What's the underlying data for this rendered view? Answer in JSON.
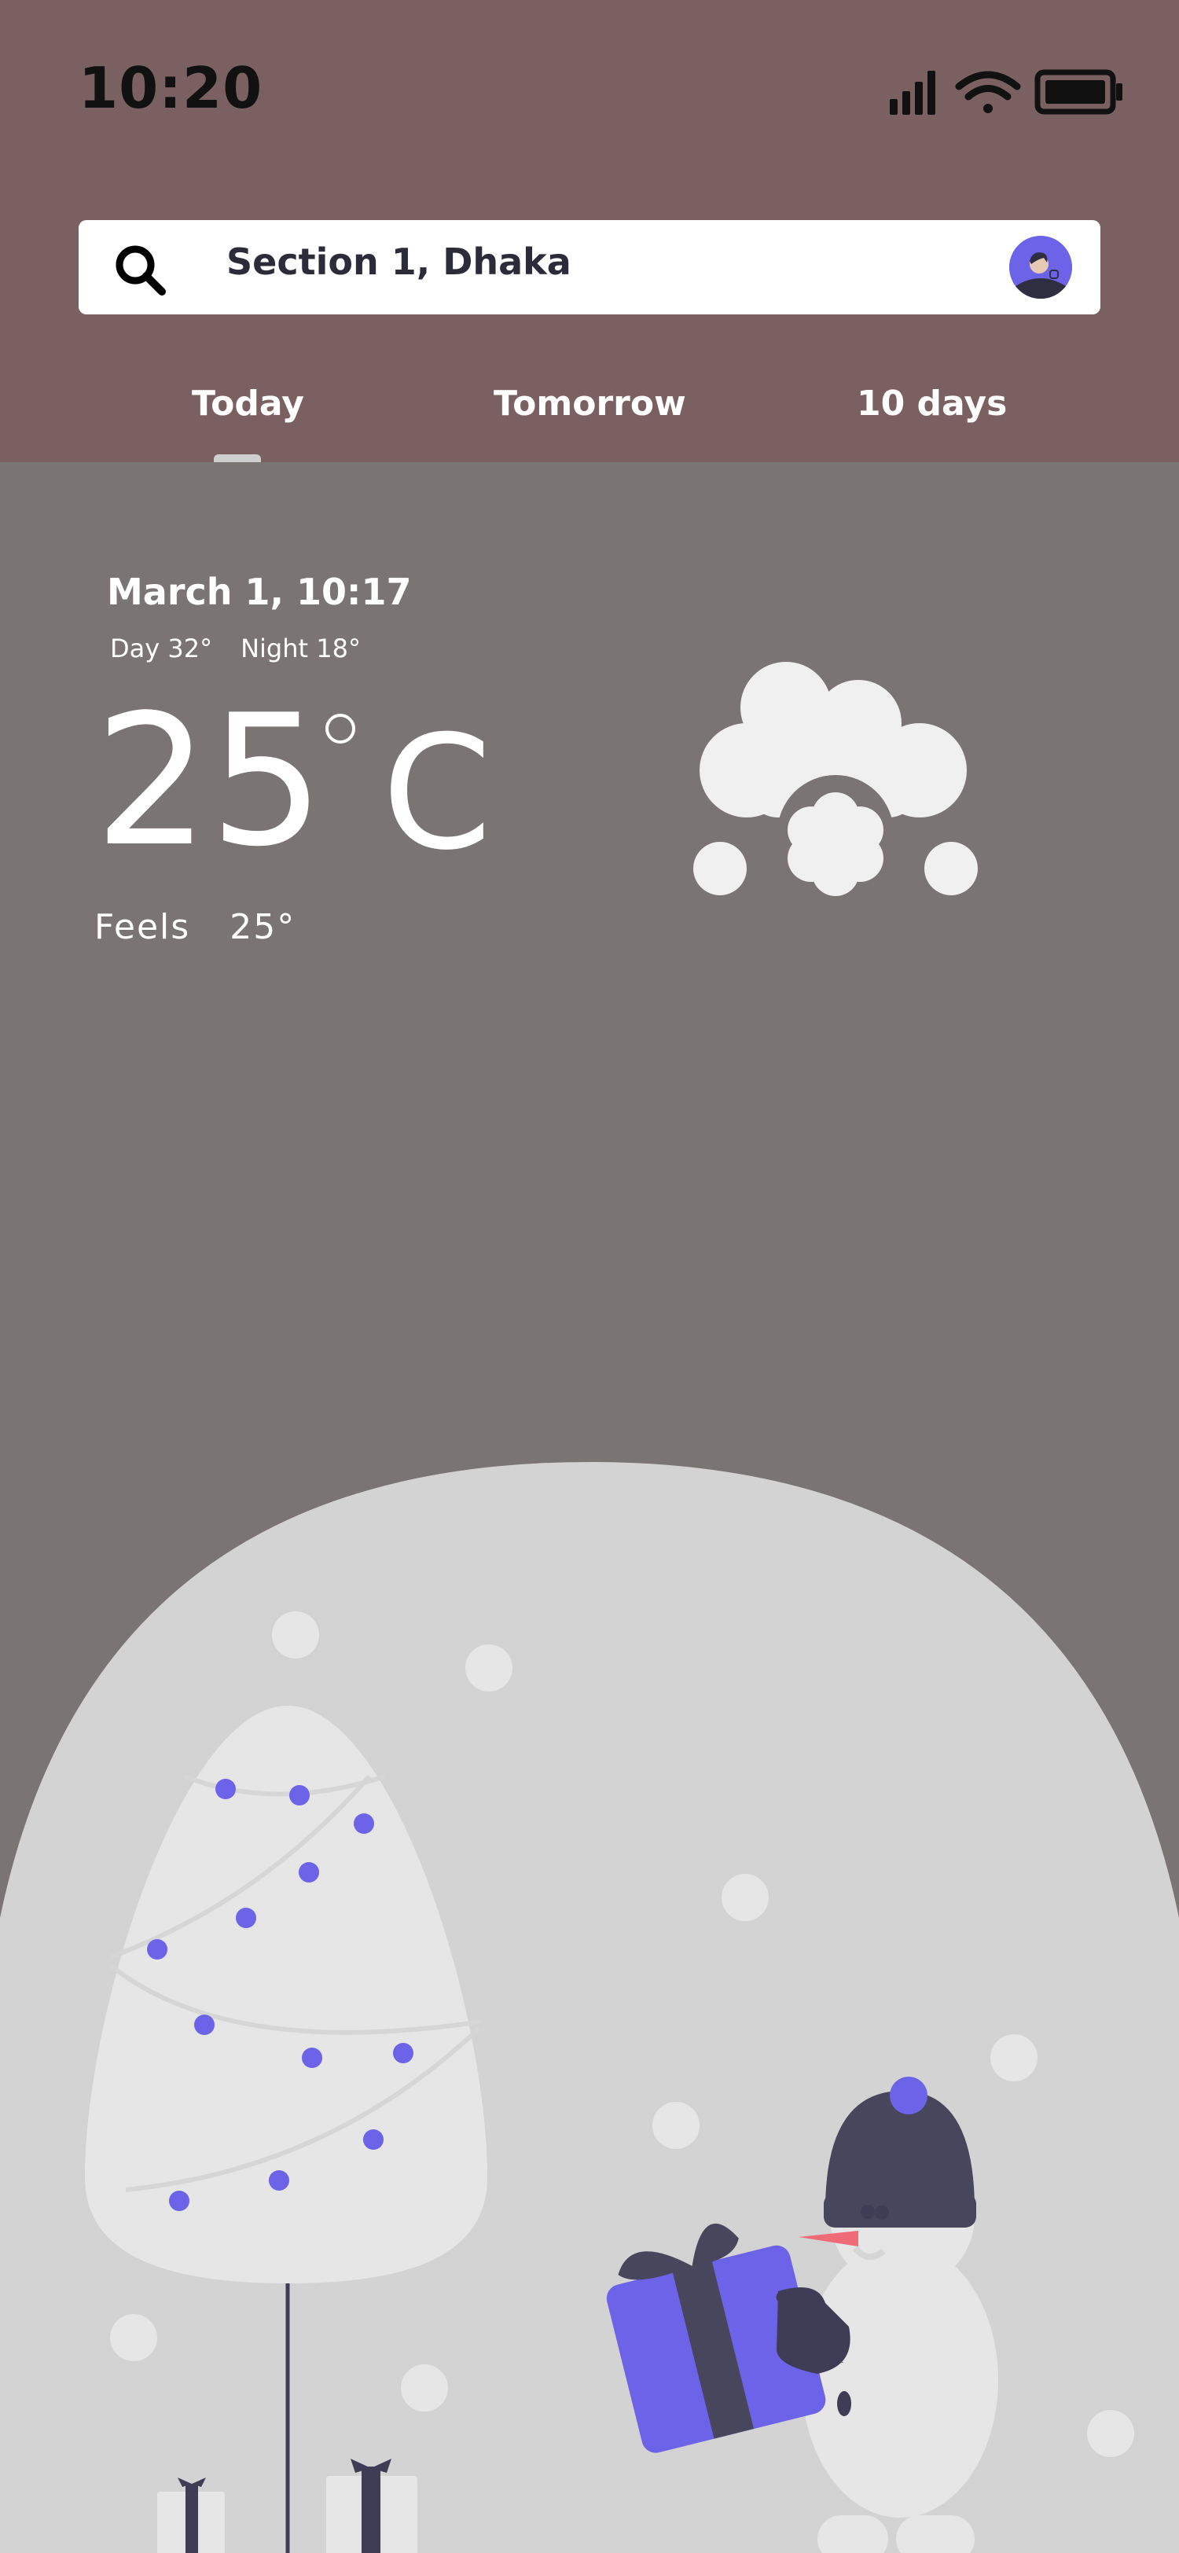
{
  "status_bar": {
    "time": "10:20",
    "icons": [
      "signal-icon",
      "wifi-icon",
      "battery-icon"
    ]
  },
  "search": {
    "location": "Section 1, Dhaka"
  },
  "tabs": [
    {
      "label": "Today",
      "active": true
    },
    {
      "label": "Tomorrow",
      "active": false
    },
    {
      "label": "10 days",
      "active": false
    }
  ],
  "weather": {
    "datetime": "March 1, 10:17",
    "day": "Day 32°",
    "night": "Night 18°",
    "temperature": "25",
    "unit": "C",
    "feels_label": "Feels",
    "feels_value": "25°",
    "condition_icon": "cloud-snow-icon"
  },
  "colors": {
    "header": "#7b6061",
    "background": "#7a7474",
    "accent": "#6c63e8",
    "illustration": "#d3d3d3"
  }
}
